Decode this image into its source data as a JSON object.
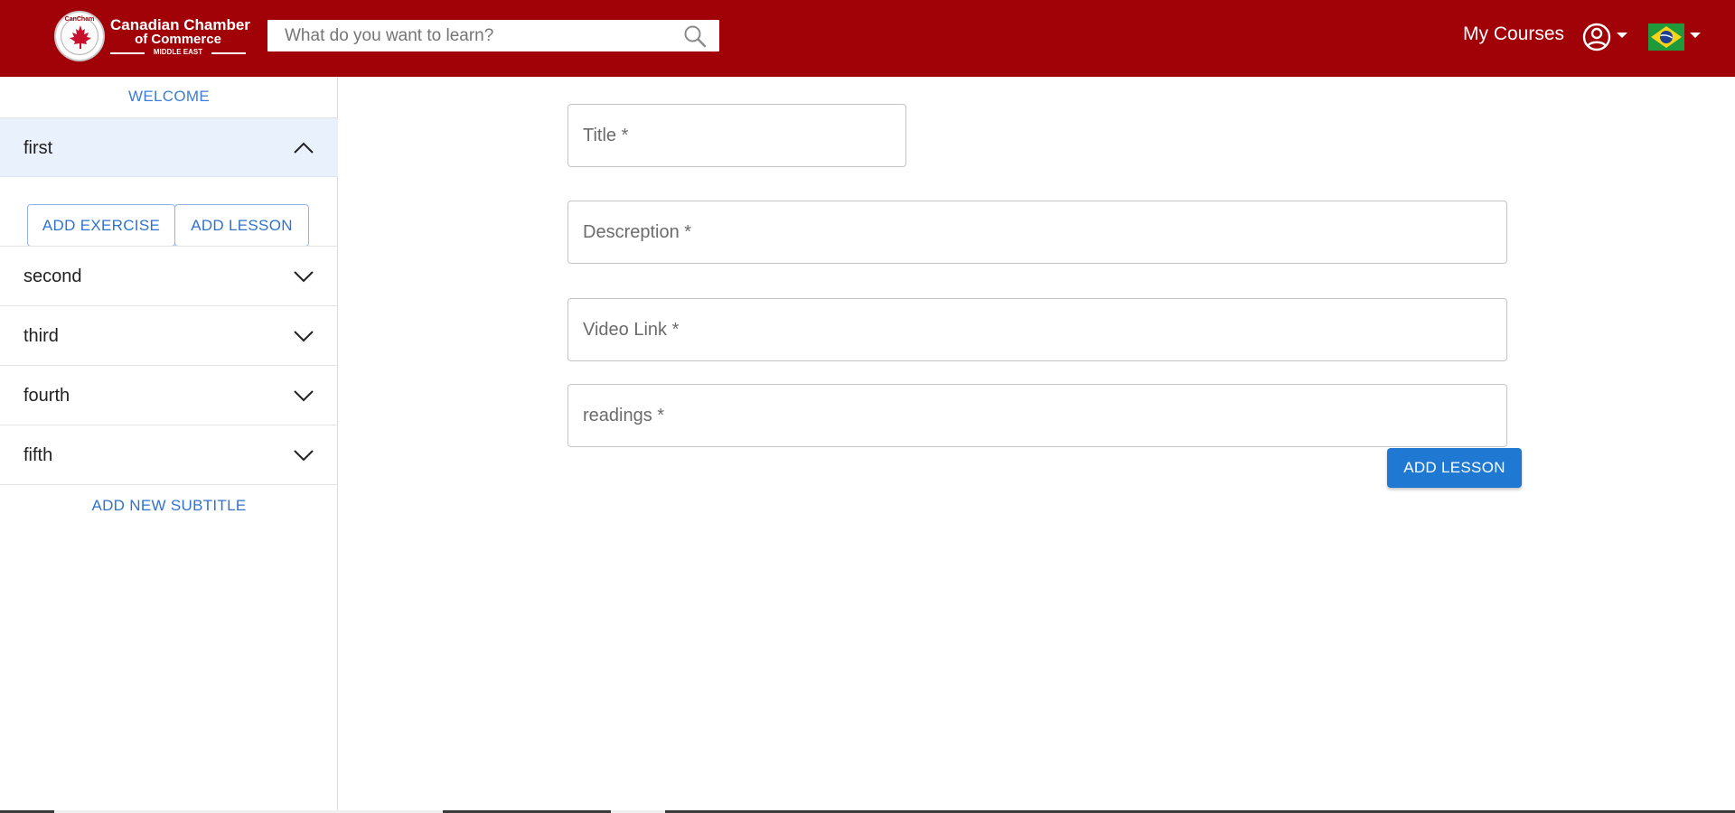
{
  "header": {
    "logo": {
      "seal_text": "CanCham",
      "line1": "Canadian Chamber",
      "line2": "of Commerce",
      "line3": "MIDDLE EAST"
    },
    "search": {
      "placeholder": "What do you want to learn?",
      "icon": "search-icon"
    },
    "my_courses_label": "My Courses",
    "account_icon": "account-circle-icon",
    "language_flag": "brazil-flag-icon",
    "colors": {
      "bar": "#a10207",
      "text": "#ffffff"
    }
  },
  "sidebar": {
    "welcome_label": "WELCOME",
    "sections": [
      {
        "label": "first",
        "expanded": true
      },
      {
        "label": "second",
        "expanded": false
      },
      {
        "label": "third",
        "expanded": false
      },
      {
        "label": "fourth",
        "expanded": false
      },
      {
        "label": "fifth",
        "expanded": false
      }
    ],
    "section_actions": {
      "add_exercise_label": "ADD EXERCISE",
      "add_lesson_label": "ADD LESSON"
    },
    "add_subtitle_label": "ADD NEW SUBTITLE",
    "colors": {
      "accent": "#2f73d0",
      "active_bg": "#e9f1fd"
    }
  },
  "form": {
    "title_placeholder": "Title *",
    "description_placeholder": "Descreption *",
    "video_link_placeholder": "Video Link *",
    "readings_placeholder": "readings *",
    "submit_label": "ADD LESSON",
    "colors": {
      "primary": "#1f78d1"
    }
  }
}
